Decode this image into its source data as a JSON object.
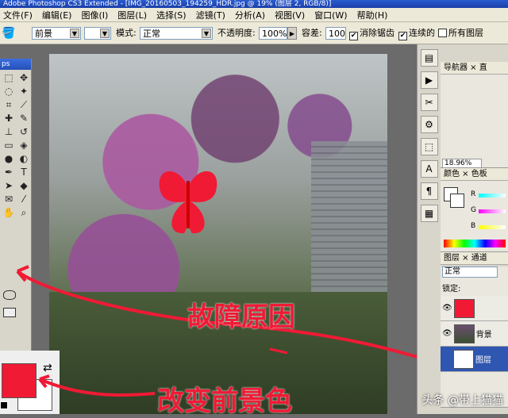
{
  "window": {
    "title": "Adobe Photoshop CS3 Extended - [IMG_20160503_194259_HDR.jpg @ 19% (图层 2, RGB/8)]"
  },
  "menu": [
    "文件(F)",
    "编辑(E)",
    "图像(I)",
    "图层(L)",
    "选择(S)",
    "滤镜(T)",
    "分析(A)",
    "视图(V)",
    "窗口(W)",
    "帮助(H)"
  ],
  "options": {
    "fill_source": "前景",
    "mode_label": "模式:",
    "mode_value": "正常",
    "opacity_label": "不透明度:",
    "opacity_value": "100%",
    "tolerance_label": "容差:",
    "tolerance_value": "100",
    "antialias_label": "消除锯齿",
    "contiguous_label": "连续的",
    "all_layers_label": "所有图层"
  },
  "toolbox": {
    "header": "ps"
  },
  "panels": {
    "navigator_tab": "导航器",
    "navigator_tab2": "直",
    "zoom_value": "18.96%",
    "color_tab": "颜色",
    "swatches_tab": "色板",
    "channel_r": "R",
    "channel_g": "G",
    "channel_b": "B",
    "layers_tab": "图层",
    "channels_tab": "通道",
    "blend_mode": "正常",
    "lock_label": "锁定:",
    "layer_names": [
      "",
      "背景",
      "图层"
    ]
  },
  "annotations": {
    "cause": "故障原因",
    "fix": "改变前景色"
  },
  "watermark": "头条 @带上猫猫",
  "colors": {
    "foreground": "#f01a35",
    "background": "#ffffff",
    "annotation": "#f01a35"
  }
}
